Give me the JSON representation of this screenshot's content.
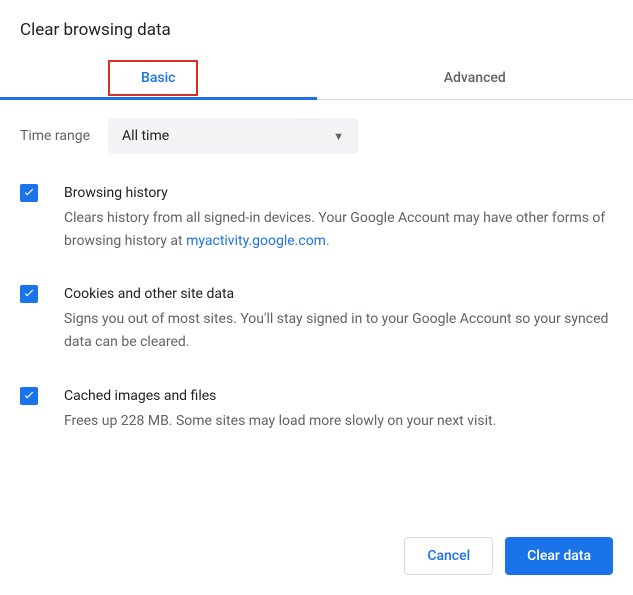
{
  "dialog": {
    "title": "Clear browsing data"
  },
  "tabs": {
    "basic": "Basic",
    "advanced": "Advanced"
  },
  "time": {
    "label": "Time range",
    "value": "All time"
  },
  "options": {
    "history": {
      "title": "Browsing history",
      "desc_before": "Clears history from all signed-in devices. Your Google Account may have other forms of browsing history at ",
      "link": "myactivity.google.com",
      "desc_after": "."
    },
    "cookies": {
      "title": "Cookies and other site data",
      "desc": "Signs you out of most sites. You'll stay signed in to your Google Account so your synced data can be cleared."
    },
    "cache": {
      "title": "Cached images and files",
      "desc": "Frees up 228 MB. Some sites may load more slowly on your next visit."
    }
  },
  "footer": {
    "cancel": "Cancel",
    "clear": "Clear data"
  }
}
